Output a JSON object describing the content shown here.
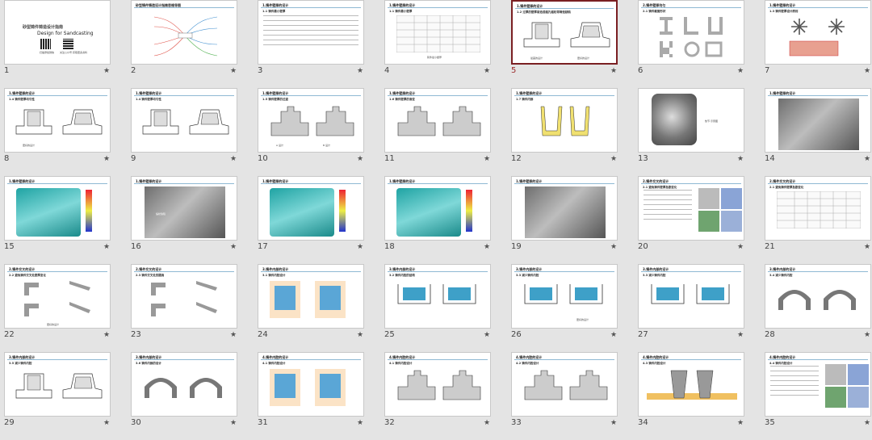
{
  "slides": [
    {
      "n": "1",
      "title": "",
      "subtitle": "",
      "cover_title": "砂型铸件铸造设计指南",
      "cover_en": "Design for Sandcasting",
      "qr1": "扫描添加微信",
      "qr2": "关注公众号 获取更多资料",
      "kind": "cover"
    },
    {
      "n": "2",
      "title": "砂型铸件铸造设计指南思维导图",
      "subtitle": "",
      "kind": "mindmap"
    },
    {
      "n": "3",
      "title": "1.铸件壁厚的设计",
      "subtitle": "1.1 铸件最小壁厚",
      "kind": "text"
    },
    {
      "n": "4",
      "title": "1.铸件壁厚的设计",
      "subtitle": "1.1 铸件最小壁厚",
      "caption": "铸件最小壁厚",
      "kind": "table"
    },
    {
      "n": "5",
      "title": "1.铸件壁厚的设计",
      "subtitle": "1.2 过厚的壁厚易造成缩孔缩松等铸造缺陷",
      "caption": "最差的设计",
      "caption2": "更好的设计",
      "kind": "drawing",
      "selected": true
    },
    {
      "n": "6",
      "title": "2.铸件壁厚均匀",
      "subtitle": "2.1 铸件截面形状",
      "kind": "shapes"
    },
    {
      "n": "7",
      "title": "1.铸件壁厚的设计",
      "subtitle": "1.3 铸件壁厚设计原则",
      "kind": "star"
    },
    {
      "n": "8",
      "title": "1.铸件壁厚的设计",
      "subtitle": "1.4 铸件壁厚均匀性",
      "caption": "更好的设计",
      "kind": "drawing"
    },
    {
      "n": "9",
      "title": "1.铸件壁厚的设计",
      "subtitle": "1.4 铸件壁厚均匀性",
      "kind": "frames"
    },
    {
      "n": "10",
      "title": "1.铸件壁厚的设计",
      "subtitle": "1.5 铸件壁厚的过渡",
      "caption": "A 设计",
      "caption2": "B 设计",
      "kind": "section"
    },
    {
      "n": "11",
      "title": "1.铸件壁厚的设计",
      "subtitle": "1.6 铸件壁厚的渐变",
      "kind": "section"
    },
    {
      "n": "12",
      "title": "1.铸件壁厚的设计",
      "subtitle": "1.7 铸件内部",
      "kind": "cups"
    },
    {
      "n": "13",
      "title": "",
      "subtitle": "",
      "caption": "热节 示意图",
      "kind": "photo3d"
    },
    {
      "n": "14",
      "title": "1.铸件壁厚的设计",
      "subtitle": "",
      "kind": "photo"
    },
    {
      "n": "15",
      "title": "1.铸件壁厚的设计",
      "subtitle": "",
      "kind": "sim"
    },
    {
      "n": "16",
      "title": "1.铸件壁厚的设计",
      "subtitle": "",
      "caption": "缩松缺陷",
      "kind": "photo"
    },
    {
      "n": "17",
      "title": "1.铸件壁厚的设计",
      "subtitle": "",
      "kind": "sim2"
    },
    {
      "n": "18",
      "title": "1.铸件壁厚的设计",
      "subtitle": "",
      "kind": "sim"
    },
    {
      "n": "19",
      "title": "1.铸件壁厚的设计",
      "subtitle": "",
      "kind": "photo"
    },
    {
      "n": "20",
      "title": "2.铸件交叉的设计",
      "subtitle": "2.1 避免铸件壁厚急剧变化",
      "kind": "textimg"
    },
    {
      "n": "21",
      "title": "2.铸件交叉的设计",
      "subtitle": "2.1 避免铸件壁厚急剧变化",
      "kind": "table"
    },
    {
      "n": "22",
      "title": "2.铸件交叉的设计",
      "subtitle": "2.2 避免铸件交叉处壁厚变化",
      "caption": "更好的设计",
      "kind": "junctions"
    },
    {
      "n": "23",
      "title": "2.铸件交叉的设计",
      "subtitle": "2.3 铸件交叉处的圆角",
      "kind": "cross"
    },
    {
      "n": "24",
      "title": "3.铸件内部的设计",
      "subtitle": "3.1 铸件内腔设计",
      "kind": "cups2"
    },
    {
      "n": "25",
      "title": "3.铸件内部的设计",
      "subtitle": "3.2 铸件内腔的结构",
      "kind": "cups3"
    },
    {
      "n": "26",
      "title": "3.铸件内部的设计",
      "subtitle": "3.3 减少铸件内腔",
      "caption": "更好的设计",
      "kind": "cups3"
    },
    {
      "n": "27",
      "title": "3.铸件内部的设计",
      "subtitle": "3.3 减少铸件内腔",
      "kind": "cups3"
    },
    {
      "n": "28",
      "title": "3.铸件内部的设计",
      "subtitle": "3.4 减少铸件内腔",
      "kind": "arches"
    },
    {
      "n": "29",
      "title": "3.铸件内部的设计",
      "subtitle": "3.5 减少铸件内腔",
      "kind": "drawing"
    },
    {
      "n": "30",
      "title": "3.铸件内部的设计",
      "subtitle": "3.6 铸件内部的设计",
      "kind": "arches"
    },
    {
      "n": "31",
      "title": "4.铸件内腔的设计",
      "subtitle": "4.1 铸件内腔设计",
      "kind": "cups2"
    },
    {
      "n": "32",
      "title": "4.铸件内腔的设计",
      "subtitle": "4.1 铸件内腔设计",
      "kind": "section"
    },
    {
      "n": "33",
      "title": "4.铸件内腔的设计",
      "subtitle": "4.2 铸件内腔设计",
      "kind": "section"
    },
    {
      "n": "34",
      "title": "4.铸件内腔的设计",
      "subtitle": "4.3 铸件内腔设计",
      "kind": "cone"
    },
    {
      "n": "35",
      "title": "4.铸件内腔的设计",
      "subtitle": "4.4 铸件内腔设计",
      "kind": "textimg"
    }
  ],
  "icons": {
    "star": "star-icon"
  },
  "colors": {
    "selected_border": "#7a1f22",
    "background": "#e4e4e4",
    "teal": "#2fb6b6"
  }
}
